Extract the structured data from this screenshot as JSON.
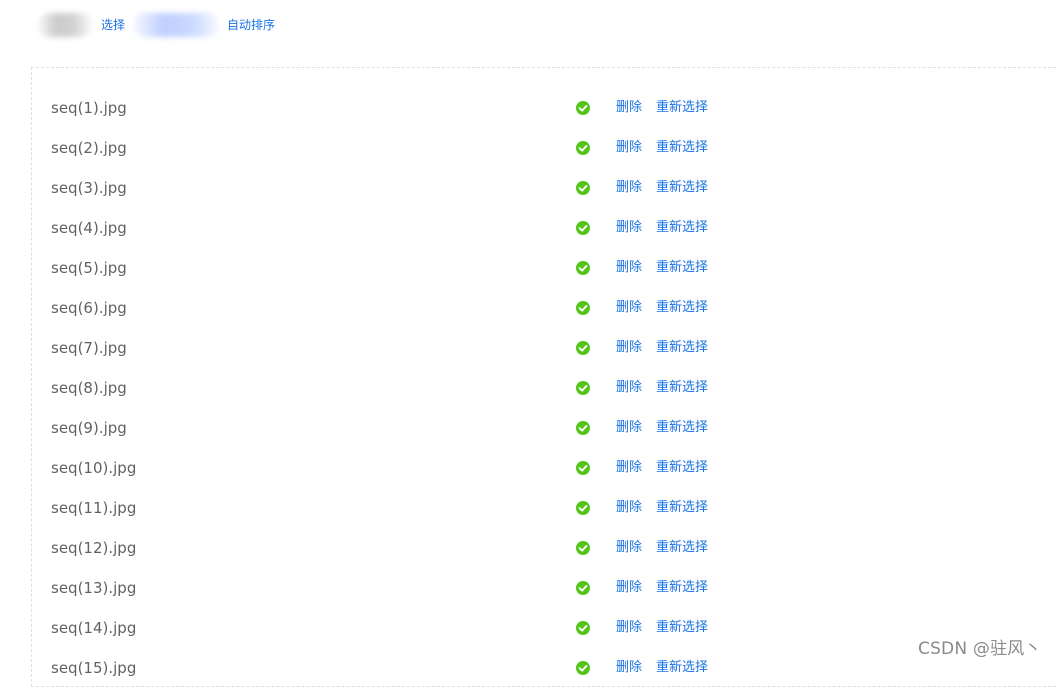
{
  "toolbar": {
    "select_label": "选择",
    "auto_sort_label": "自动排序"
  },
  "files": [
    {
      "name": "seq(1).jpg"
    },
    {
      "name": "seq(2).jpg"
    },
    {
      "name": "seq(3).jpg"
    },
    {
      "name": "seq(4).jpg"
    },
    {
      "name": "seq(5).jpg"
    },
    {
      "name": "seq(6).jpg"
    },
    {
      "name": "seq(7).jpg"
    },
    {
      "name": "seq(8).jpg"
    },
    {
      "name": "seq(9).jpg"
    },
    {
      "name": "seq(10).jpg"
    },
    {
      "name": "seq(11).jpg"
    },
    {
      "name": "seq(12).jpg"
    },
    {
      "name": "seq(13).jpg"
    },
    {
      "name": "seq(14).jpg"
    },
    {
      "name": "seq(15).jpg"
    }
  ],
  "row_actions": {
    "delete_label": "删除",
    "reselect_label": "重新选择"
  },
  "status_icon": "check-circle-icon",
  "colors": {
    "link": "#1a73e8",
    "success": "#52c41a",
    "text": "#606266",
    "panel_border": "#dcdfe6"
  },
  "watermark": "CSDN @驻风丶"
}
